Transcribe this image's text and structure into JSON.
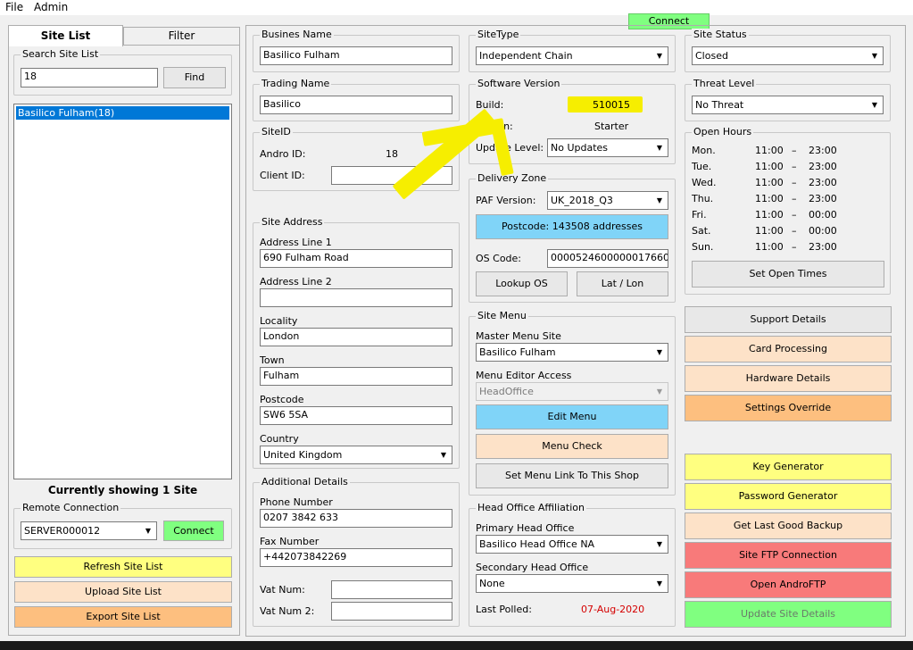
{
  "menu": {
    "file": "File",
    "admin": "Admin"
  },
  "top_connect": "Connect",
  "left": {
    "tab_site_list": "Site List",
    "tab_filter": "Filter",
    "search_group": "Search Site List",
    "search_value": "18",
    "find_button": "Find",
    "list_items": [
      "Basilico Fulham(18)"
    ],
    "showing_text": "Currently showing 1 Site",
    "remote_group": "Remote Connection",
    "server_value": "SERVER000012",
    "connect_button": "Connect",
    "refresh_button": "Refresh Site List",
    "upload_button": "Upload Site List",
    "export_button": "Export Site List"
  },
  "business": {
    "legend": "Busines Name",
    "value": "Basilico Fulham"
  },
  "trading": {
    "legend": "Trading Name",
    "value": "Basilico"
  },
  "siteid": {
    "legend": "SiteID",
    "andro_label": "Andro ID:",
    "andro_value": "18",
    "client_label": "Client ID:",
    "client_value": ""
  },
  "address": {
    "legend": "Site Address",
    "line1_label": "Address Line 1",
    "line1_value": "690 Fulham Road",
    "line2_label": "Address Line 2",
    "line2_value": "",
    "locality_label": "Locality",
    "locality_value": "London",
    "town_label": "Town",
    "town_value": "Fulham",
    "postcode_label": "Postcode",
    "postcode_value": "SW6 5SA",
    "country_label": "Country",
    "country_value": "United Kingdom"
  },
  "additional": {
    "legend": "Additional Details",
    "phone_label": "Phone Number",
    "phone_value": "0207 3842 633",
    "fax_label": "Fax Number",
    "fax_value": "+442073842269",
    "vat_label": "Vat Num:",
    "vat_value": "",
    "vat2_label": "Vat Num 2:",
    "vat2_value": ""
  },
  "sitetype": {
    "legend": "SiteType",
    "value": "Independent Chain"
  },
  "software": {
    "legend": "Software Version",
    "build_label": "Build:",
    "build_value": "510015",
    "edition_label": "Edition:",
    "edition_value": "Starter",
    "update_label": "Update Level:",
    "update_value": "No Updates"
  },
  "delivery": {
    "legend": "Delivery Zone",
    "paf_label": "PAF Version:",
    "paf_value": "UK_2018_Q3",
    "postcode_button": "Postcode: 143508 addresses",
    "os_label": "OS Code:",
    "os_value": "00005246000000176600",
    "lookup_button": "Lookup OS",
    "latlon_button": "Lat / Lon"
  },
  "sitemenu": {
    "legend": "Site Menu",
    "master_label": "Master Menu Site",
    "master_value": "Basilico Fulham",
    "editor_label": "Menu Editor Access",
    "editor_value": "HeadOffice",
    "edit_menu_button": "Edit Menu",
    "menu_check_button": "Menu Check",
    "set_link_button": "Set Menu Link To This Shop"
  },
  "headoffice": {
    "legend": "Head Office Affiliation",
    "primary_label": "Primary Head Office",
    "primary_value": "Basilico Head Office NA",
    "secondary_label": "Secondary Head Office",
    "secondary_value": "None",
    "polled_label": "Last Polled:",
    "polled_value": "07-Aug-2020"
  },
  "status": {
    "legend": "Site Status",
    "value": "Closed"
  },
  "threat": {
    "legend": "Threat Level",
    "value": "No Threat"
  },
  "hours": {
    "legend": "Open Hours",
    "rows": [
      {
        "day": "Mon.",
        "open": "11:00",
        "sep": "–",
        "close": "23:00"
      },
      {
        "day": "Tue.",
        "open": "11:00",
        "sep": "–",
        "close": "23:00"
      },
      {
        "day": "Wed.",
        "open": "11:00",
        "sep": "–",
        "close": "23:00"
      },
      {
        "day": "Thu.",
        "open": "11:00",
        "sep": "–",
        "close": "23:00"
      },
      {
        "day": "Fri.",
        "open": "11:00",
        "sep": "–",
        "close": "00:00"
      },
      {
        "day": "Sat.",
        "open": "11:00",
        "sep": "–",
        "close": "00:00"
      },
      {
        "day": "Sun.",
        "open": "11:00",
        "sep": "–",
        "close": "23:00"
      }
    ],
    "set_button": "Set Open Times"
  },
  "right_buttons": {
    "support": "Support Details",
    "card": "Card Processing",
    "hardware": "Hardware Details",
    "settings": "Settings Override",
    "keygen": "Key Generator",
    "passgen": "Password Generator",
    "backup": "Get Last Good Backup",
    "ftp": "Site FTP Connection",
    "androftp": "Open AndroFTP",
    "update": "Update Site Details"
  },
  "colors": {
    "yellow": "#ffff80",
    "peach": "#fde2c8",
    "orange": "#fdbf7f",
    "blue": "#80d4f8",
    "green": "#80ff80",
    "red": "#f87a7a",
    "highlight": "#f6ee00",
    "selection": "#0078d7",
    "polled_red": "#d40000"
  }
}
